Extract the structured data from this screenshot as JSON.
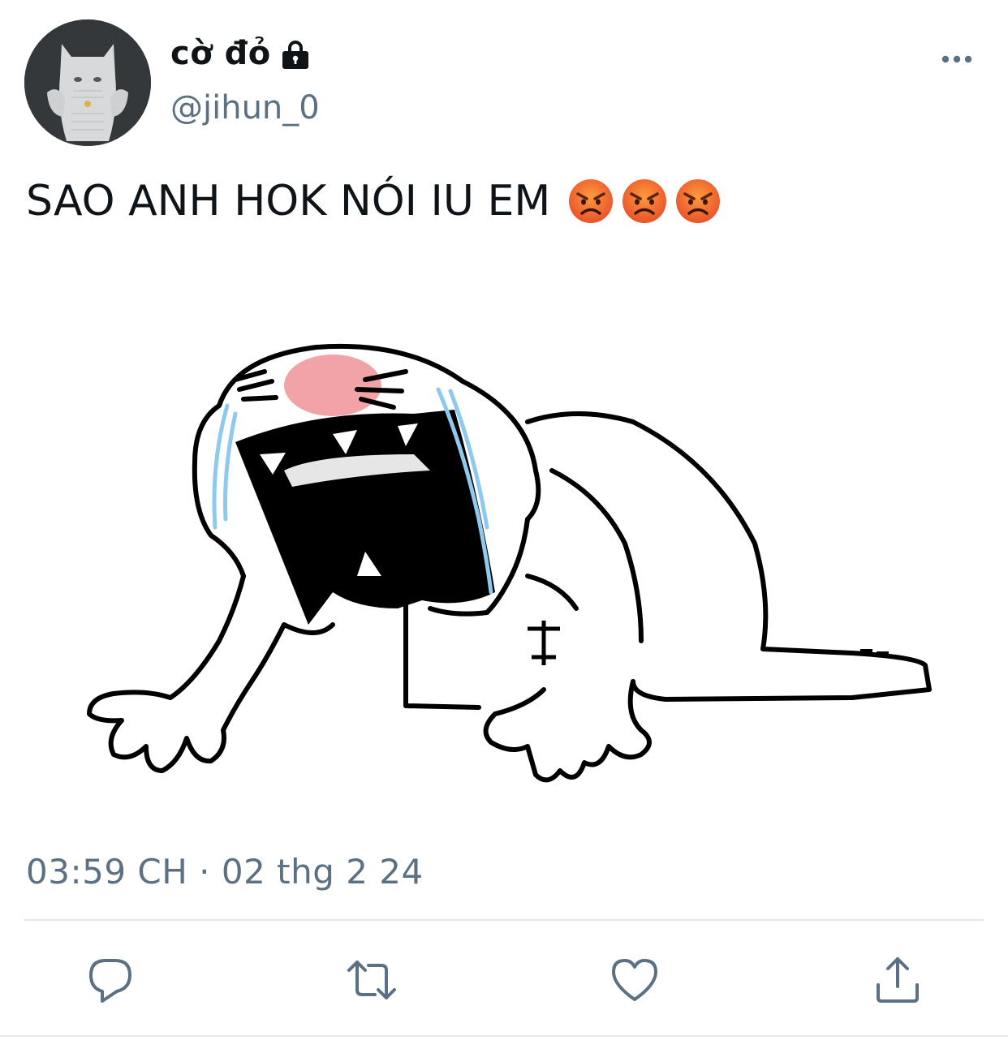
{
  "tweet": {
    "author": {
      "display_name": "cờ đỏ",
      "handle": "@jihun_0",
      "protected": true
    },
    "text": "SAO ANH HOK NÓI IU EM",
    "emojis": [
      "angry-face-emoji",
      "angry-face-emoji",
      "angry-face-emoji"
    ],
    "timestamp": "03:59 CH · 02 thg 2 24"
  },
  "icons": {
    "lock": "lock-icon",
    "more": "more-icon",
    "reply": "reply-icon",
    "retweet": "retweet-icon",
    "like": "heart-icon",
    "share": "share-icon"
  },
  "colors": {
    "text_primary": "#0f1419",
    "text_secondary": "#5b7083",
    "divider": "#e1e8ed",
    "action_icon": "#5b7083"
  }
}
